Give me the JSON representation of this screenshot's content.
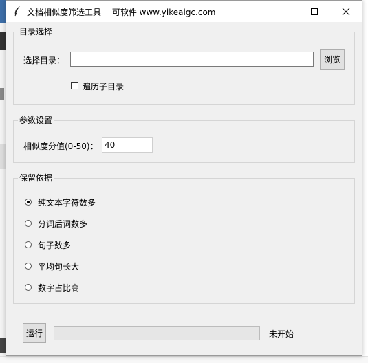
{
  "window": {
    "title": "文档相似度筛选工具 一可软件 www.yikeaigc.com",
    "minimize_icon": "minimize-icon",
    "maximize_icon": "maximize-icon",
    "close_icon": "close-icon"
  },
  "directory_group": {
    "title": "目录选择",
    "select_label": "选择目录：",
    "dir_value": "",
    "browse_label": "浏览",
    "recursive_label": "遍历子目录",
    "recursive_checked": false
  },
  "params_group": {
    "title": "参数设置",
    "threshold_label": "相似度分值(0-50)：",
    "threshold_value": "40"
  },
  "retain_group": {
    "title": "保留依据",
    "options": [
      {
        "label": "纯文本字符数多",
        "selected": true
      },
      {
        "label": "分词后词数多",
        "selected": false
      },
      {
        "label": "句子数多",
        "selected": false
      },
      {
        "label": "平均句长大",
        "selected": false
      },
      {
        "label": "数字占比高",
        "selected": false
      }
    ]
  },
  "footer": {
    "run_label": "运行",
    "progress": 0,
    "status": "未开始"
  }
}
